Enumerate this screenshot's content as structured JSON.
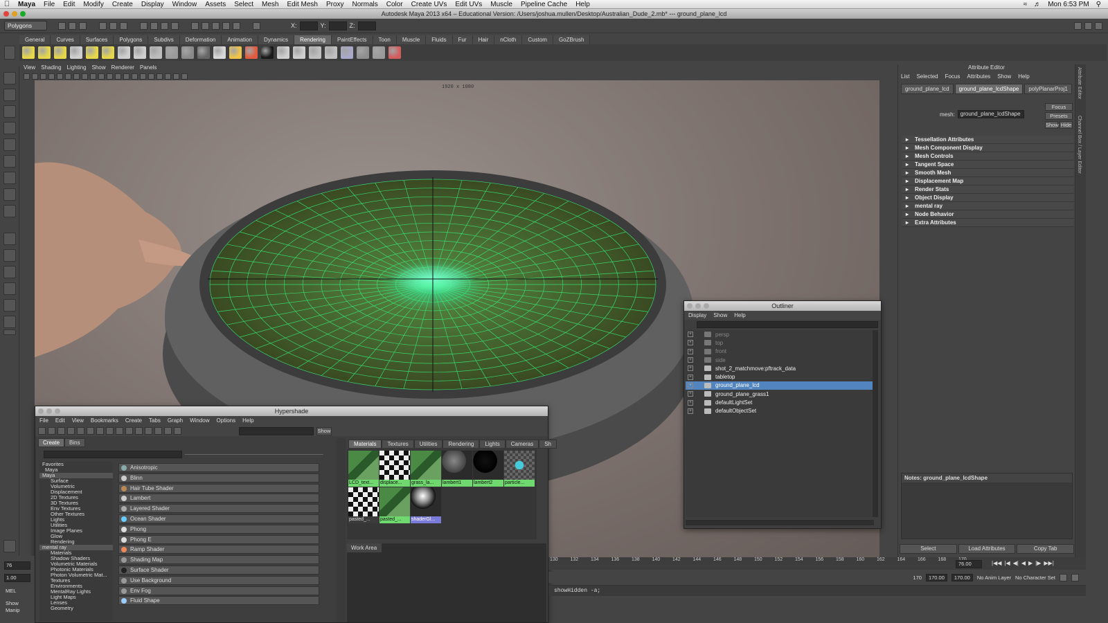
{
  "menubar": {
    "app": "Maya",
    "items": [
      "File",
      "Edit",
      "Modify",
      "Create",
      "Display",
      "Window",
      "Assets",
      "Select",
      "Mesh",
      "Edit Mesh",
      "Proxy",
      "Normals",
      "Color",
      "Create UVs",
      "Edit UVs",
      "Muscle",
      "Pipeline Cache",
      "Help"
    ],
    "clock": "Mon 6:53 PM"
  },
  "window_title": "Autodesk Maya 2013 x64 – Educational Version: /Users/joshua.mullen/Desktop/Australian_Dude_2.mb*   ---   ground_plane_lcd",
  "statusline": {
    "menuset": "Polygons",
    "x_label": "X:",
    "y_label": "Y:",
    "z_label": "Z:"
  },
  "shelf": {
    "tabs": [
      "General",
      "Curves",
      "Surfaces",
      "Polygons",
      "Subdivs",
      "Deformation",
      "Animation",
      "Dynamics",
      "Rendering",
      "PaintEffects",
      "Toon",
      "Muscle",
      "Fluids",
      "Fur",
      "Hair",
      "nCloth",
      "Custom",
      "GoZBrush"
    ],
    "active_tab": "Rendering",
    "button_colors": [
      "#e5d64a",
      "#e5d64a",
      "#e5d64a",
      "#cfcfcf",
      "#e5d64a",
      "#e5d64a",
      "#cfcfcf",
      "#cfcfcf",
      "#bdbdbd",
      "#9a9a9a",
      "#8a8a8a",
      "#666",
      "#d8d8d8",
      "#f0c34a",
      "#e05b3f",
      "#1a1a1a",
      "#cfcfcf",
      "#cfcfcf",
      "#bfbfbf",
      "#bfbfbf",
      "#a8a8c8",
      "#8f8f8f",
      "#9a9a9a",
      "#d35d5d"
    ]
  },
  "viewport": {
    "menu": [
      "View",
      "Shading",
      "Lighting",
      "Show",
      "Renderer",
      "Panels"
    ],
    "resolution_gate": "1920 x 1080"
  },
  "attribute_editor": {
    "title": "Attribute Editor",
    "menu": [
      "List",
      "Selected",
      "Focus",
      "Attributes",
      "Show",
      "Help"
    ],
    "tabs": [
      "ground_plane_lcd",
      "ground_plane_lcdShape",
      "polyPlanarProj1"
    ],
    "active_tab": "ground_plane_lcdShape",
    "mesh_label": "mesh:",
    "mesh_value": "ground_plane_lcdShape",
    "focus_btn": "Focus",
    "presets_btn": "Presets",
    "show_btn": "Show",
    "hide_btn": "Hide",
    "sections": [
      "Tessellation Attributes",
      "Mesh Component Display",
      "Mesh Controls",
      "Tangent Space",
      "Smooth Mesh",
      "Displacement Map",
      "Render Stats",
      "Object Display",
      "mental ray",
      "Node Behavior",
      "Extra Attributes"
    ],
    "notes_label": "Notes:  ground_plane_lcdShape",
    "buttons": [
      "Select",
      "Load Attributes",
      "Copy Tab"
    ],
    "side_tabs": [
      "Attribute Editor",
      "Channel Box / Layer Editor"
    ]
  },
  "outliner": {
    "title": "Outliner",
    "menu": [
      "Display",
      "Show",
      "Help"
    ],
    "items": [
      {
        "name": "persp",
        "state": "dim"
      },
      {
        "name": "top",
        "state": "dim"
      },
      {
        "name": "front",
        "state": "dim"
      },
      {
        "name": "side",
        "state": "dim"
      },
      {
        "name": "shot_2_matchmove:pftrack_data",
        "state": "normal"
      },
      {
        "name": "tabletop",
        "state": "normal"
      },
      {
        "name": "ground_plane_lcd",
        "state": "selected"
      },
      {
        "name": "ground_plane_grass1",
        "state": "normal"
      },
      {
        "name": "defaultLightSet",
        "state": "normal"
      },
      {
        "name": "defaultObjectSet",
        "state": "normal"
      }
    ]
  },
  "hypershade": {
    "title": "Hypershade",
    "menu": [
      "File",
      "Edit",
      "View",
      "Bookmarks",
      "Create",
      "Tabs",
      "Graph",
      "Window",
      "Options",
      "Help"
    ],
    "show_btn": "Show",
    "left_tabs": [
      "Create",
      "Bins"
    ],
    "tree": [
      "Favorites",
      "Maya",
      "Maya",
      "Surface",
      "Volumetric",
      "Displacement",
      "2D Textures",
      "3D Textures",
      "Env Textures",
      "Other Textures",
      "Lights",
      "Utilities",
      "Image Planes",
      "Glow",
      "Rendering",
      "mental ray",
      "Materials",
      "Shadow Shaders",
      "Volumetric Materials",
      "Photonic Materials",
      "Photon Volumetric Mat...",
      "Textures",
      "Environments",
      "MentalRay Lights",
      "Light Maps",
      "Lenses",
      "Geometry"
    ],
    "shaders": [
      "Anisotropic",
      "Blinn",
      "Hair Tube Shader",
      "Lambert",
      "Layered Shader",
      "Ocean Shader",
      "Phong",
      "Phong E",
      "Ramp Shader",
      "Shading Map",
      "Surface Shader",
      "Use Background",
      "Env Fog",
      "Fluid Shape"
    ],
    "mat_tabs": [
      "Materials",
      "Textures",
      "Utilities",
      "Rendering",
      "Lights",
      "Cameras",
      "Sh"
    ],
    "swatches": [
      {
        "label": "LCD_text...",
        "kind": "grass",
        "tag": "green"
      },
      {
        "label": "displace...",
        "kind": "checker",
        "tag": "green"
      },
      {
        "label": "grass_la...",
        "kind": "grass",
        "tag": "green"
      },
      {
        "label": "lambert1",
        "kind": "grey",
        "tag": "green"
      },
      {
        "label": "lambert2",
        "kind": "black",
        "tag": "green"
      },
      {
        "label": "particle...",
        "kind": "particle",
        "tag": "green"
      },
      {
        "label": "pasted_...",
        "kind": "checker",
        "tag": "plain"
      },
      {
        "label": "pasted_...",
        "kind": "grass",
        "tag": "green"
      },
      {
        "label": "shaderGl...",
        "kind": "chrome",
        "tag": "selected"
      }
    ],
    "work_area": "Work Area"
  },
  "timeline": {
    "ticks": [
      "130",
      "132",
      "134",
      "136",
      "138",
      "140",
      "142",
      "144",
      "146",
      "148",
      "150",
      "152",
      "154",
      "156",
      "158",
      "160",
      "162",
      "164",
      "166",
      "168",
      "170"
    ],
    "current": "76.00",
    "range_start": "170.00",
    "range_end": "170.00",
    "range_pre": "170",
    "anim_layer": "No Anim Layer",
    "char_set": "No Character Set"
  },
  "commandline": {
    "lang": "MEL",
    "result": "showHidden -a;",
    "frame_left": "76",
    "value_left": "1.00",
    "hint": "Show Manip"
  }
}
